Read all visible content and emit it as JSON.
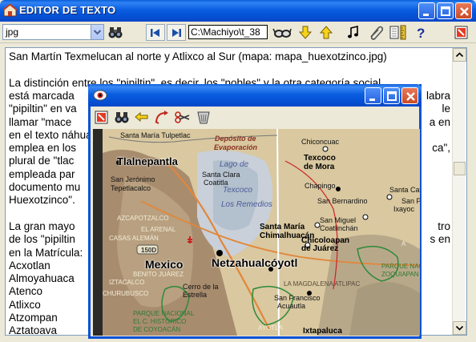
{
  "app": {
    "title": "EDITOR DE TEXTO"
  },
  "toolbar": {
    "combo_value": "jpg",
    "path_value": "C:\\Machiyo\\t_38",
    "buttons": [
      "binoculars-icon",
      "first-icon",
      "last-icon",
      "glasses-icon",
      "down-arrow-icon",
      "up-arrow-icon",
      "music-icon",
      "paperclip-icon",
      "ruler-icon",
      "help-icon",
      "exit-icon"
    ]
  },
  "editor": {
    "lines": [
      "San Martín Texmelucan al norte y Atlixco al Sur (mapa: mapa_huexotzinco.jpg)",
      "",
      " La distinción entre los \"pipiltin\", es decir, los \"nobles\" y la otra categoría social",
      "está marcada",
      "\"pipiltin\" en va",
      "llamar \"mace",
      "en el texto náhuat",
      "emplea en los",
      "plural de \"tlac",
      "empleada par",
      "documento mu",
      "Huexotzinco\".",
      "",
      " La gran mayo",
      "de los \"pipiltin",
      "en la Matrícula:",
      " Acxotlan",
      " Almoyahuaca",
      " Atenco",
      " Atlixco",
      " Atzompan",
      " Aztatoava"
    ],
    "right_fragments": [
      {
        "line": 3,
        "text": "labra"
      },
      {
        "line": 4,
        "text": "le"
      },
      {
        "line": 5,
        "text": "a en"
      },
      {
        "line": 7,
        "text": "ca\","
      },
      {
        "line": 13,
        "text": "tro"
      },
      {
        "line": 14,
        "text": "s en"
      }
    ]
  },
  "map_window": {
    "toolbar_buttons": [
      "exit-icon",
      "binoculars-icon",
      "back-arrow-icon",
      "curve-arrow-icon",
      "scissors-icon",
      "trash-icon"
    ],
    "labels": [
      {
        "text": "Santa María Tulpetlac",
        "style": "small"
      },
      {
        "text": "Depósito de",
        "style": "red-italic"
      },
      {
        "text": "Evaporación",
        "style": "red-italic"
      },
      {
        "text": "Chiconcuac",
        "style": "small"
      },
      {
        "text": "Tlalnepantla",
        "style": "bold"
      },
      {
        "text": "Lago de",
        "style": "blue-italic"
      },
      {
        "text": "Texcoco",
        "style": "blue-italic"
      },
      {
        "text": "Texcoco",
        "style": "bold-small"
      },
      {
        "text": "de Mora",
        "style": "bold-small"
      },
      {
        "text": "Santa Clara",
        "style": "small"
      },
      {
        "text": "Coatitla",
        "style": "small"
      },
      {
        "text": "San Jerónimo",
        "style": "small"
      },
      {
        "text": "Tepetlacalco",
        "style": "small"
      },
      {
        "text": "Chapingo",
        "style": "small"
      },
      {
        "text": "Santa Catarina",
        "style": "small"
      },
      {
        "text": "Los Remedios",
        "style": "blue-italic"
      },
      {
        "text": "San Bernardino",
        "style": "small"
      },
      {
        "text": "San Pablo",
        "style": "small"
      },
      {
        "text": "Ixayoc",
        "style": "small"
      },
      {
        "text": "AZCAPOTZALCO",
        "style": "district"
      },
      {
        "text": "EL ARENAL",
        "style": "district"
      },
      {
        "text": "CASAS ALEMÁN",
        "style": "district"
      },
      {
        "text": "Santa María",
        "style": "bold-small"
      },
      {
        "text": "Chimalhuacán",
        "style": "bold-small"
      },
      {
        "text": "San Miguel",
        "style": "small"
      },
      {
        "text": "Coatlinchán",
        "style": "small"
      },
      {
        "text": "Chicoloapan",
        "style": "bold-small"
      },
      {
        "text": "de Juárez",
        "style": "bold-small"
      },
      {
        "text": "150D",
        "style": "shield"
      },
      {
        "text": "Mexico",
        "style": "big"
      },
      {
        "text": "Netzahualcóyotl",
        "style": "big"
      },
      {
        "text": "PARQUE NACIO",
        "style": "green"
      },
      {
        "text": "ZOQUIAPAN Y AN",
        "style": "green"
      },
      {
        "text": "BENITO JUÁREZ",
        "style": "district"
      },
      {
        "text": "LA MAGDALENA ATLIPAC",
        "style": "district-light"
      },
      {
        "text": "IZTACALCO",
        "style": "district"
      },
      {
        "text": "Cerro de la",
        "style": "small"
      },
      {
        "text": "Estrella",
        "style": "small"
      },
      {
        "text": "San Francisco",
        "style": "small"
      },
      {
        "text": "Acuautla",
        "style": "small"
      },
      {
        "text": "PARQUE NACIONAL",
        "style": "green"
      },
      {
        "text": "EL C. HISTÓRICO",
        "style": "green"
      },
      {
        "text": "DE COYOACÁN",
        "style": "green"
      },
      {
        "text": "AYOTLA",
        "style": "district"
      },
      {
        "text": "Ixtapaluca",
        "style": "bold-small"
      },
      {
        "text": "CHURUBUSCO",
        "style": "district"
      },
      {
        "text": "A",
        "style": "district"
      }
    ]
  },
  "colors": {
    "titlebar": "#0553d7",
    "map_land": "#d9c8a0",
    "map_urban": "#a88c6e",
    "map_lake": "#c9d0d9"
  }
}
